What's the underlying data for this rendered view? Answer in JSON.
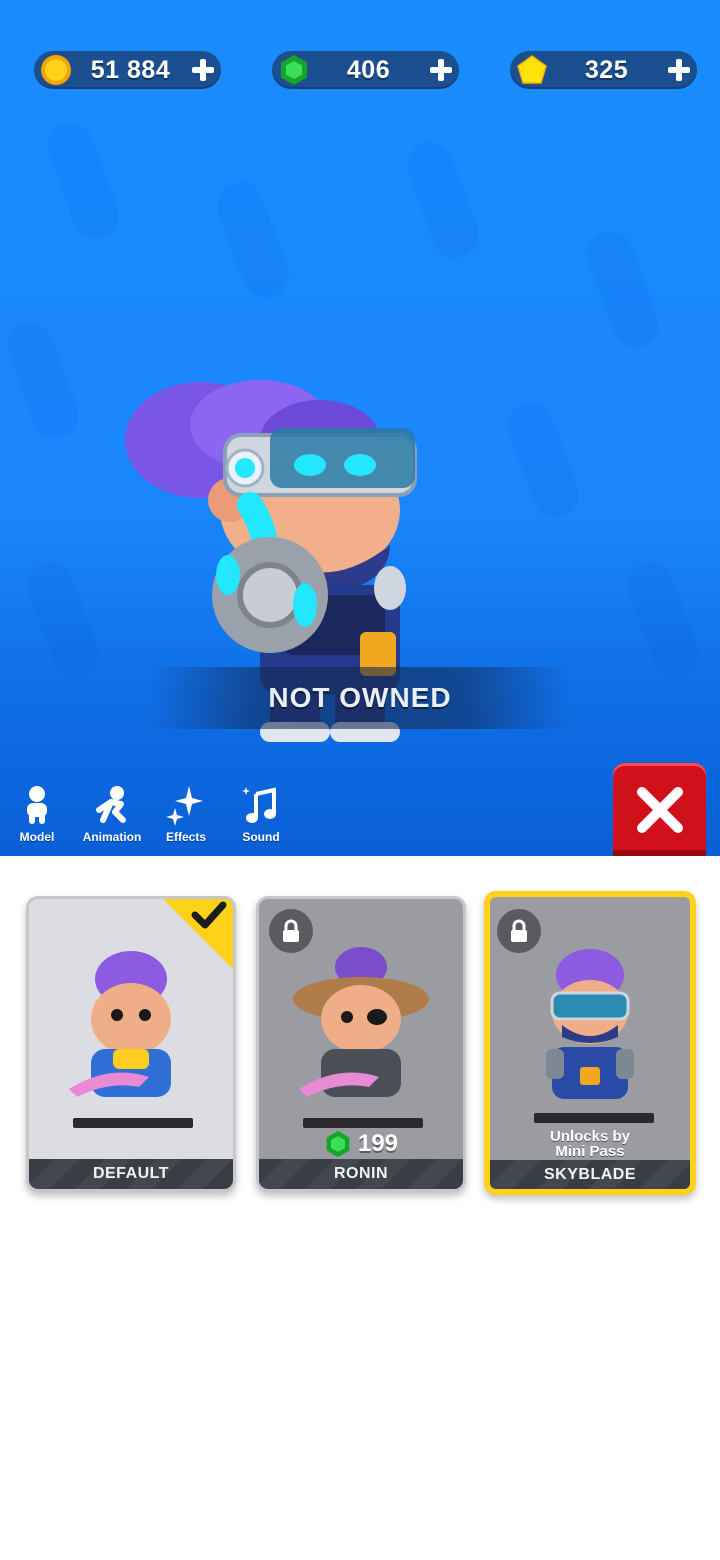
{
  "currencies": {
    "coins": {
      "icon": "coin-icon",
      "value": "51 884",
      "color": "#ffcb10"
    },
    "gems": {
      "icon": "gem-icon",
      "value": "406",
      "color": "#22c03a"
    },
    "stars": {
      "icon": "pentagon-icon",
      "value": "325",
      "color": "#ffe20a"
    }
  },
  "preview": {
    "status": "NOT OWNED",
    "background_color": "#1a8cff"
  },
  "toolbar": {
    "items": [
      {
        "icon": "model-icon",
        "label": "Model"
      },
      {
        "icon": "animation-icon",
        "label": "Animation"
      },
      {
        "icon": "effects-icon",
        "label": "Effects"
      },
      {
        "icon": "sound-icon",
        "label": "Sound"
      }
    ],
    "close_icon": "close-icon",
    "close_color": "#d0101a"
  },
  "skins": [
    {
      "name": "DEFAULT",
      "state": "owned-selected",
      "badge_icon": "check-icon"
    },
    {
      "name": "RONIN",
      "state": "locked",
      "badge_icon": "lock-icon",
      "price_icon": "gem-icon",
      "price": "199"
    },
    {
      "name": "SKYBLADE",
      "state": "locked-previewing",
      "badge_icon": "lock-icon",
      "unlock_line1": "Unlocks by",
      "unlock_line2": "Mini Pass",
      "highlight_color": "#ffd21a"
    }
  ]
}
